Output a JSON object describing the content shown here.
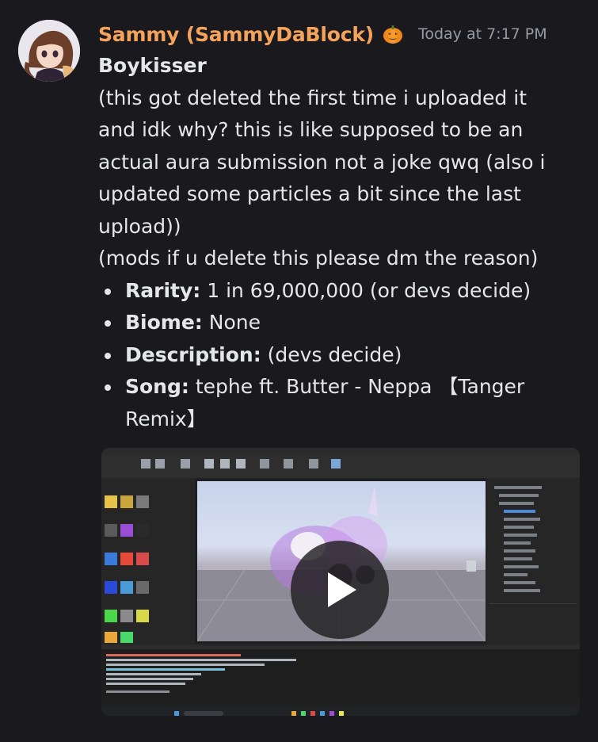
{
  "author": {
    "name": "Sammy (SammyDaBlock)",
    "badge_icon": "pumpkin-icon",
    "name_color": "#f5a35a"
  },
  "timestamp": "Today at 7:17 PM",
  "message": {
    "title": "Boykisser",
    "body_lines": [
      "(this got deleted the first time i uploaded it",
      "and idk why? this is like supposed to be an",
      "actual aura submission not a joke qwq (also i",
      "updated some particles a bit since the last",
      "upload))",
      "(mods if u delete this please dm the reason)"
    ],
    "details": [
      {
        "key": "Rarity:",
        "value": "1 in 69,000,000 (or devs decide)"
      },
      {
        "key": "Biome:",
        "value": "None"
      },
      {
        "key": "Description:",
        "value": "(devs decide)"
      },
      {
        "key": "Song:",
        "value": "tephe ft. Butter - Neppa 【Tanger"
      }
    ],
    "song_continuation": "Remix】"
  },
  "video": {
    "play_icon": "play-icon"
  },
  "colors": {
    "background": "#1a1a1e",
    "text": "#e4e6ea",
    "timestamp": "#959aa3"
  }
}
